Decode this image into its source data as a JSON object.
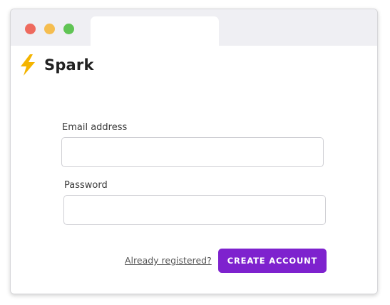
{
  "window": {
    "controls": {
      "close_color": "#ee6a5e",
      "minimize_color": "#f5bd4f",
      "maximize_color": "#60c454"
    }
  },
  "brand": {
    "icon": "lightning-bolt-icon",
    "icon_color": "#f4b400",
    "name": "Spark"
  },
  "form": {
    "email": {
      "label": "Email address",
      "value": "",
      "placeholder": ""
    },
    "password": {
      "label": "Password",
      "value": "",
      "placeholder": ""
    },
    "already_registered_link": "Already registered?",
    "submit_label": "CREATE ACCOUNT"
  },
  "colors": {
    "accent": "#7e22ce"
  }
}
